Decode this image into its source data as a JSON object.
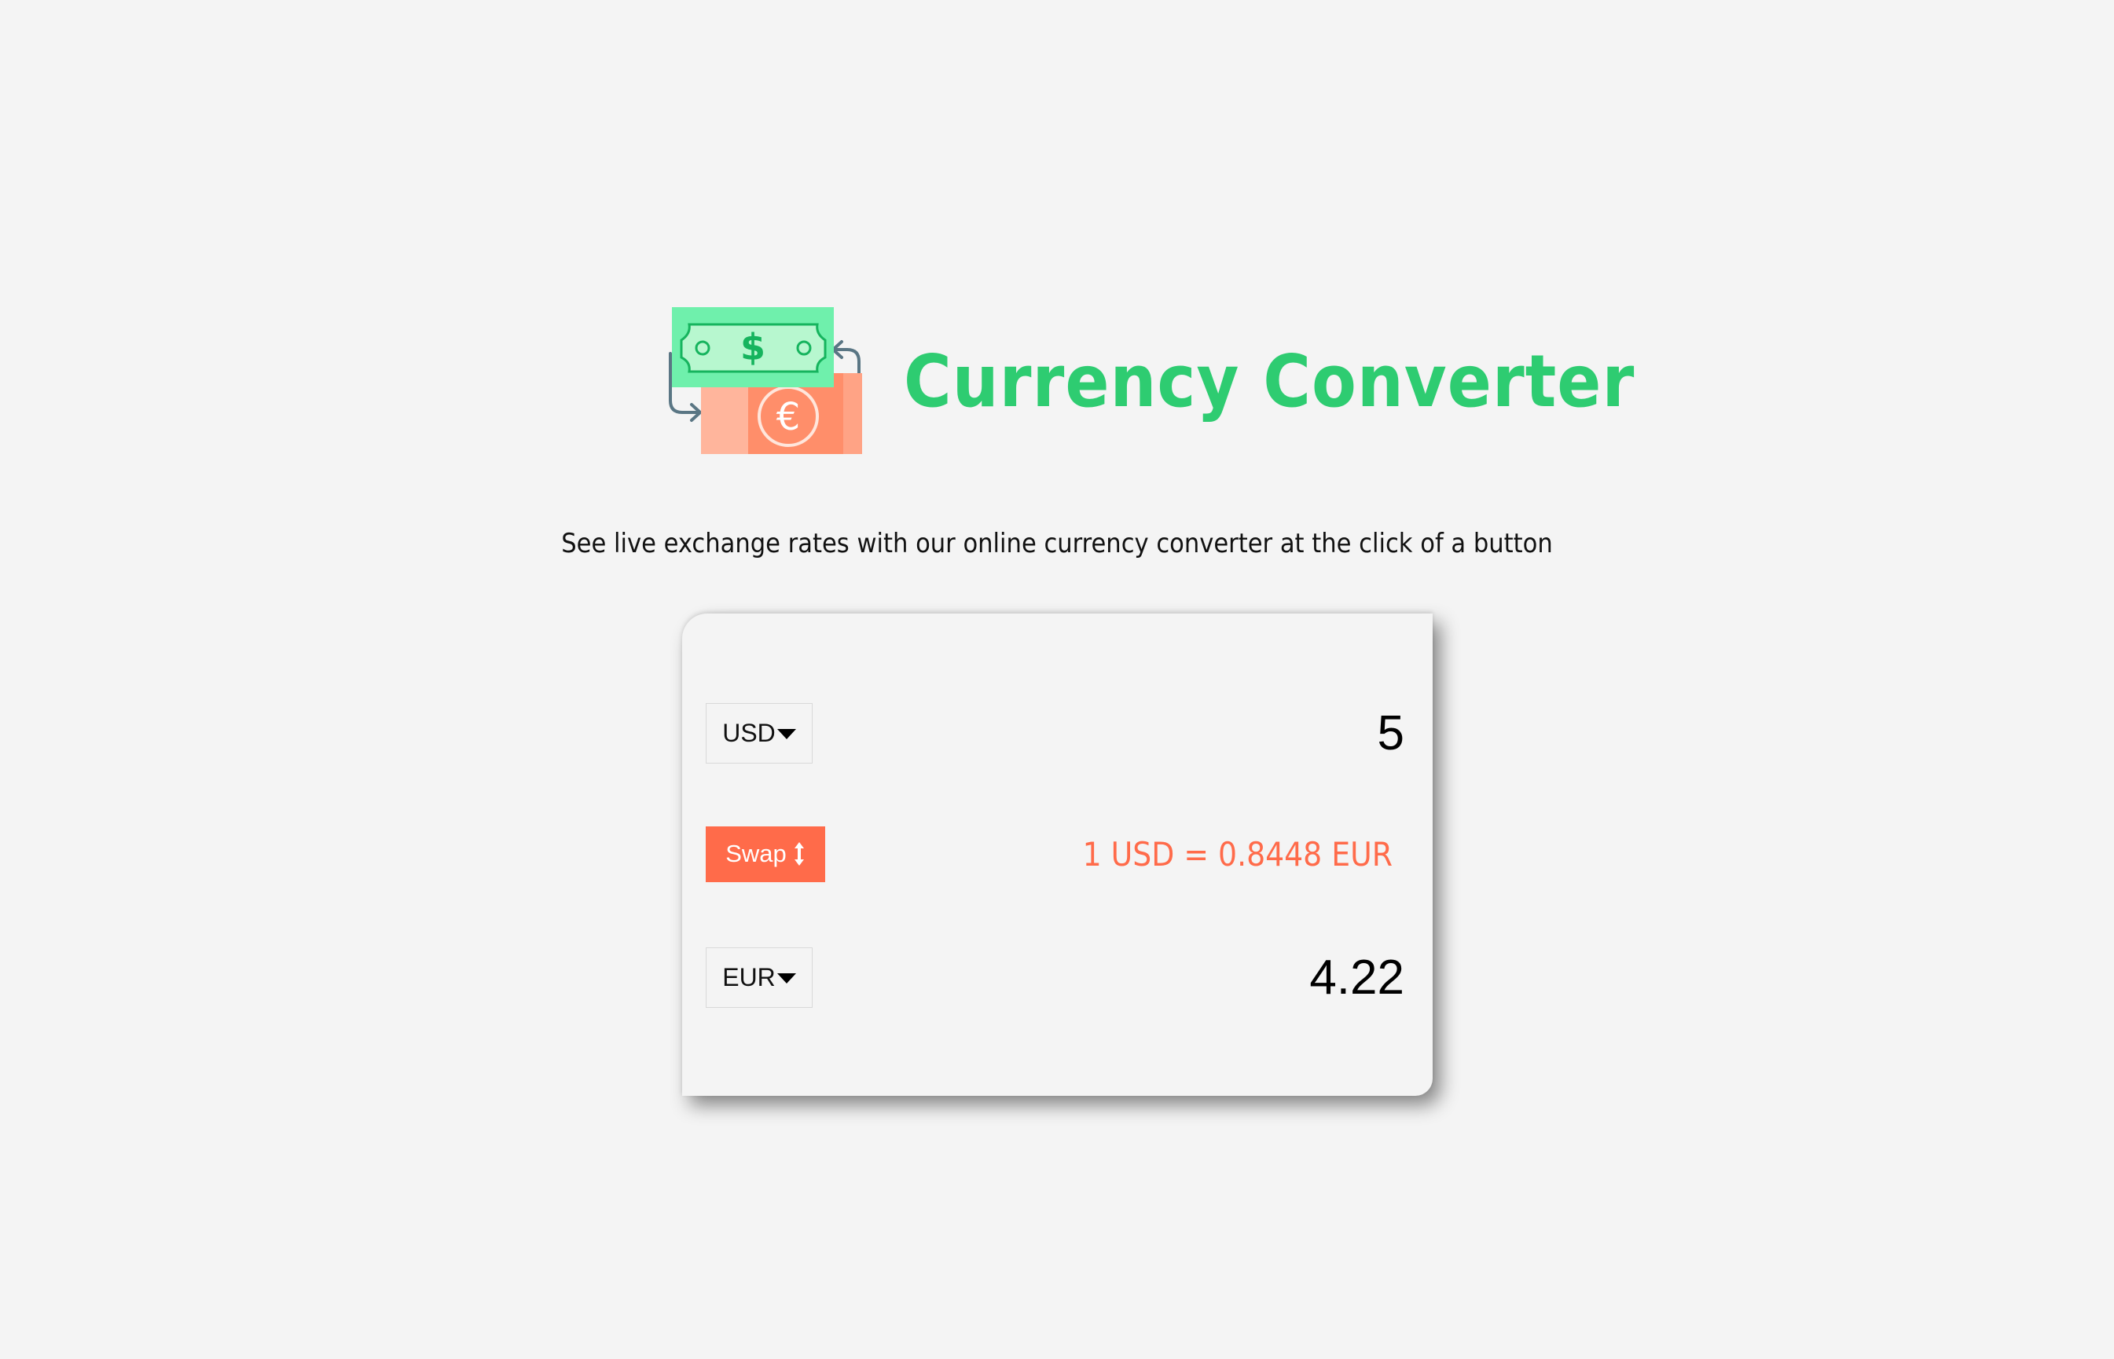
{
  "header": {
    "title": "Currency Converter",
    "logo_icon": "money-exchange-icon"
  },
  "subtitle": "See live exchange rates with our online currency converter at the click of a button",
  "converter": {
    "from": {
      "currency": "USD",
      "amount": "5"
    },
    "swap": {
      "label": "Swap",
      "icon": "swap-vertical-arrows-icon"
    },
    "rate": "1 USD = 0.8448 EUR",
    "to": {
      "currency": "EUR",
      "amount": "4.22"
    }
  },
  "colors": {
    "title_green": "#2ecc71",
    "accent_orange": "#ff6b4a",
    "background": "#f4f4f4"
  }
}
